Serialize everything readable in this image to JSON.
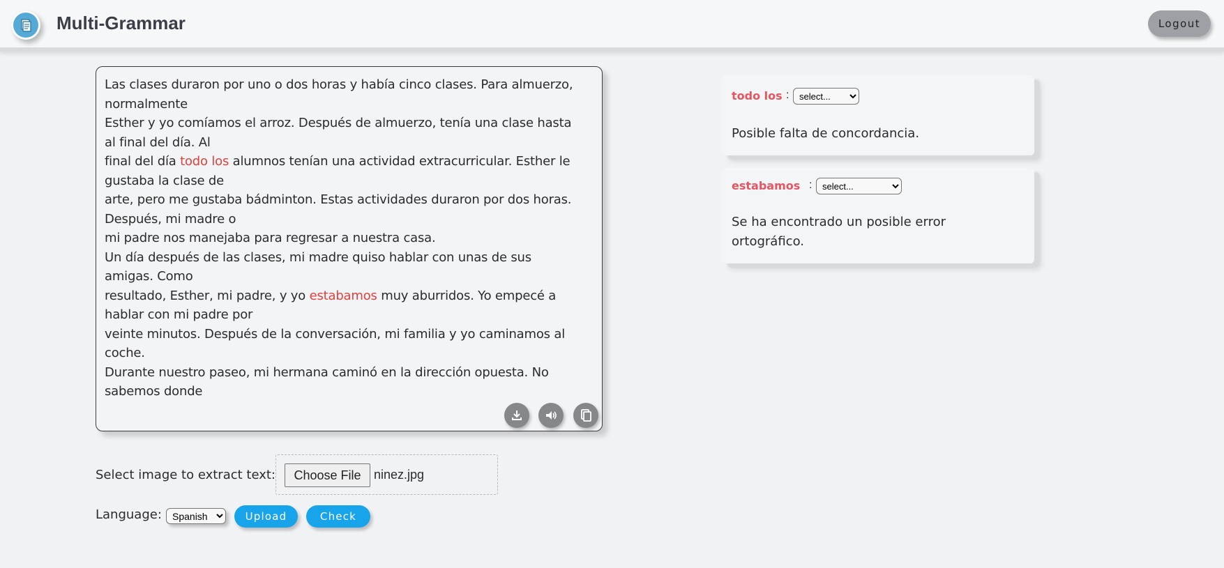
{
  "header": {
    "app_title": "Multi-Grammar",
    "logout_label": "Logout"
  },
  "editor": {
    "lines": [
      [
        "Las clases duraron por uno o dos horas y había cinco clases. Para almuerzo,"
      ],
      [
        "normalmente"
      ],
      [
        "Esther y yo comíamos el arroz. Después de almuerzo, tenía una clase hasta"
      ],
      [
        "al final del día. Al"
      ],
      [
        "final del día ",
        "todo los",
        " alumnos tenían una actividad extracurricular. Esther le"
      ],
      [
        "gustaba la clase de"
      ],
      [
        "arte, pero me gustaba bádminton. Estas actividades duraron por dos horas."
      ],
      [
        "Después, mi madre o"
      ],
      [
        "mi padre nos manejaba para regresar a nuestra casa."
      ],
      [
        "Un día después de las clases, mi madre quiso hablar con unas de sus"
      ],
      [
        "amigas. Como"
      ],
      [
        "resultado, Esther, mi padre, y yo ",
        "estabamos",
        " muy aburridos. Yo empecé a"
      ],
      [
        "hablar con mi padre por"
      ],
      [
        "veinte minutos. Después de la conversación, mi familia y yo caminamos al"
      ],
      [
        "coche."
      ],
      [
        "Durante nuestro paseo, mi hermana caminó en la dirección opuesta. No"
      ],
      [
        "sabemos donde"
      ]
    ],
    "tools": [
      "download-icon",
      "speaker-icon",
      "copy-icon"
    ]
  },
  "upload": {
    "select_label": "Select image to extract text:",
    "choose_button": "Choose File",
    "file_name": "ninez.jpg",
    "language_label": "Language:",
    "language_value": "Spanish",
    "upload_button": "Upload",
    "check_button": "Check"
  },
  "suggestions": [
    {
      "word": "todo los",
      "colon": ":",
      "select_value": "select...",
      "message": "Posible falta de concordancia."
    },
    {
      "word": "estabamos",
      "colon": ":",
      "select_value": "select...",
      "message": "Se ha encontrado un posible error ortográfico."
    }
  ],
  "colors": {
    "accent": "#18a4ea",
    "error": "#e1403e",
    "card_word": "#e65561"
  }
}
